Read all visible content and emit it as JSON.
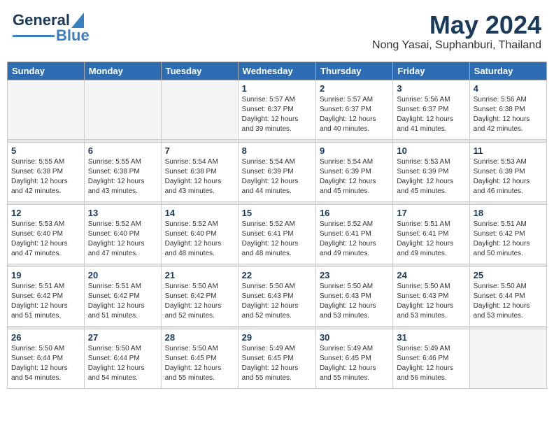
{
  "header": {
    "logo": {
      "line1": "General",
      "line2": "Blue"
    },
    "title": "May 2024",
    "subtitle": "Nong Yasai, Suphanburi, Thailand"
  },
  "weekdays": [
    "Sunday",
    "Monday",
    "Tuesday",
    "Wednesday",
    "Thursday",
    "Friday",
    "Saturday"
  ],
  "weeks": [
    {
      "days": [
        {
          "num": "",
          "info": ""
        },
        {
          "num": "",
          "info": ""
        },
        {
          "num": "",
          "info": ""
        },
        {
          "num": "1",
          "info": "Sunrise: 5:57 AM\nSunset: 6:37 PM\nDaylight: 12 hours\nand 39 minutes."
        },
        {
          "num": "2",
          "info": "Sunrise: 5:57 AM\nSunset: 6:37 PM\nDaylight: 12 hours\nand 40 minutes."
        },
        {
          "num": "3",
          "info": "Sunrise: 5:56 AM\nSunset: 6:37 PM\nDaylight: 12 hours\nand 41 minutes."
        },
        {
          "num": "4",
          "info": "Sunrise: 5:56 AM\nSunset: 6:38 PM\nDaylight: 12 hours\nand 42 minutes."
        }
      ]
    },
    {
      "days": [
        {
          "num": "5",
          "info": "Sunrise: 5:55 AM\nSunset: 6:38 PM\nDaylight: 12 hours\nand 42 minutes."
        },
        {
          "num": "6",
          "info": "Sunrise: 5:55 AM\nSunset: 6:38 PM\nDaylight: 12 hours\nand 43 minutes."
        },
        {
          "num": "7",
          "info": "Sunrise: 5:54 AM\nSunset: 6:38 PM\nDaylight: 12 hours\nand 43 minutes."
        },
        {
          "num": "8",
          "info": "Sunrise: 5:54 AM\nSunset: 6:39 PM\nDaylight: 12 hours\nand 44 minutes."
        },
        {
          "num": "9",
          "info": "Sunrise: 5:54 AM\nSunset: 6:39 PM\nDaylight: 12 hours\nand 45 minutes."
        },
        {
          "num": "10",
          "info": "Sunrise: 5:53 AM\nSunset: 6:39 PM\nDaylight: 12 hours\nand 45 minutes."
        },
        {
          "num": "11",
          "info": "Sunrise: 5:53 AM\nSunset: 6:39 PM\nDaylight: 12 hours\nand 46 minutes."
        }
      ]
    },
    {
      "days": [
        {
          "num": "12",
          "info": "Sunrise: 5:53 AM\nSunset: 6:40 PM\nDaylight: 12 hours\nand 47 minutes."
        },
        {
          "num": "13",
          "info": "Sunrise: 5:52 AM\nSunset: 6:40 PM\nDaylight: 12 hours\nand 47 minutes."
        },
        {
          "num": "14",
          "info": "Sunrise: 5:52 AM\nSunset: 6:40 PM\nDaylight: 12 hours\nand 48 minutes."
        },
        {
          "num": "15",
          "info": "Sunrise: 5:52 AM\nSunset: 6:41 PM\nDaylight: 12 hours\nand 48 minutes."
        },
        {
          "num": "16",
          "info": "Sunrise: 5:52 AM\nSunset: 6:41 PM\nDaylight: 12 hours\nand 49 minutes."
        },
        {
          "num": "17",
          "info": "Sunrise: 5:51 AM\nSunset: 6:41 PM\nDaylight: 12 hours\nand 49 minutes."
        },
        {
          "num": "18",
          "info": "Sunrise: 5:51 AM\nSunset: 6:42 PM\nDaylight: 12 hours\nand 50 minutes."
        }
      ]
    },
    {
      "days": [
        {
          "num": "19",
          "info": "Sunrise: 5:51 AM\nSunset: 6:42 PM\nDaylight: 12 hours\nand 51 minutes."
        },
        {
          "num": "20",
          "info": "Sunrise: 5:51 AM\nSunset: 6:42 PM\nDaylight: 12 hours\nand 51 minutes."
        },
        {
          "num": "21",
          "info": "Sunrise: 5:50 AM\nSunset: 6:42 PM\nDaylight: 12 hours\nand 52 minutes."
        },
        {
          "num": "22",
          "info": "Sunrise: 5:50 AM\nSunset: 6:43 PM\nDaylight: 12 hours\nand 52 minutes."
        },
        {
          "num": "23",
          "info": "Sunrise: 5:50 AM\nSunset: 6:43 PM\nDaylight: 12 hours\nand 53 minutes."
        },
        {
          "num": "24",
          "info": "Sunrise: 5:50 AM\nSunset: 6:43 PM\nDaylight: 12 hours\nand 53 minutes."
        },
        {
          "num": "25",
          "info": "Sunrise: 5:50 AM\nSunset: 6:44 PM\nDaylight: 12 hours\nand 53 minutes."
        }
      ]
    },
    {
      "days": [
        {
          "num": "26",
          "info": "Sunrise: 5:50 AM\nSunset: 6:44 PM\nDaylight: 12 hours\nand 54 minutes."
        },
        {
          "num": "27",
          "info": "Sunrise: 5:50 AM\nSunset: 6:44 PM\nDaylight: 12 hours\nand 54 minutes."
        },
        {
          "num": "28",
          "info": "Sunrise: 5:50 AM\nSunset: 6:45 PM\nDaylight: 12 hours\nand 55 minutes."
        },
        {
          "num": "29",
          "info": "Sunrise: 5:49 AM\nSunset: 6:45 PM\nDaylight: 12 hours\nand 55 minutes."
        },
        {
          "num": "30",
          "info": "Sunrise: 5:49 AM\nSunset: 6:45 PM\nDaylight: 12 hours\nand 55 minutes."
        },
        {
          "num": "31",
          "info": "Sunrise: 5:49 AM\nSunset: 6:46 PM\nDaylight: 12 hours\nand 56 minutes."
        },
        {
          "num": "",
          "info": ""
        }
      ]
    }
  ]
}
